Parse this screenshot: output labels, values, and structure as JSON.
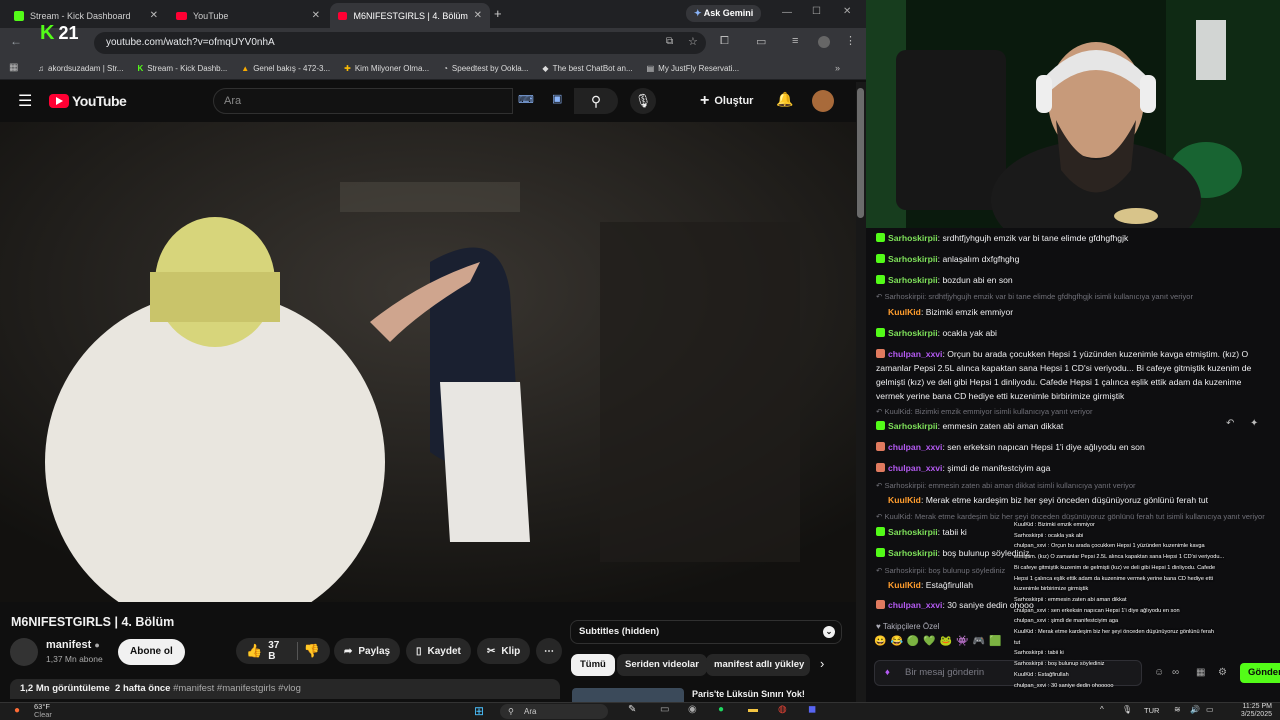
{
  "browser": {
    "tabs": [
      {
        "label": "Stream - Kick Dashboard"
      },
      {
        "label": "YouTube"
      },
      {
        "label": "M6NIFESTGIRLS | 4. Bölüm - Yo"
      }
    ],
    "ask_gemini": "Ask Gemini",
    "url": "youtube.com/watch?v=ofmqUYV0nhA",
    "bookmarks": [
      "akordsuzadam | Str...",
      "Stream - Kick Dashb...",
      "Genel bakış - 472-3...",
      "Kim Milyoner Olma...",
      "Speedtest by Ookla...",
      "The best ChatBot an...",
      "My JustFly Reservati..."
    ],
    "kick_overlay_count": "21"
  },
  "youtube": {
    "logo_text": "YouTube",
    "search_placeholder": "Ara",
    "create_label": "Oluştur",
    "video_title": "M6NIFESTGIRLS | 4. Bölüm",
    "channel_name": "manifest",
    "subscribers": "1,37 Mn abone",
    "subscribe_label": "Abone ol",
    "likes": "37 B",
    "share_label": "Paylaş",
    "save_label": "Kaydet",
    "clip_label": "Klip",
    "views": "1,2 Mn görüntüleme",
    "age": "2 hafta önce",
    "tags": "#manifest #manifestgirls #vlog",
    "subtitles": "Subtitles (hidden)",
    "chips": [
      "Tümü",
      "Seriden videolar",
      "manifest adlı yükley"
    ],
    "next_video_title": "Paris'te Lüksün Sınırı Yok!"
  },
  "chat": {
    "messages": [
      {
        "type": "msg",
        "user": "Sarhoskirpii",
        "color": "#7ee05a",
        "text": "srdhtfjyhgujh emzik var bi tane elimde gfdhgfhgjk"
      },
      {
        "type": "msg",
        "user": "Sarhoskirpii",
        "color": "#7ee05a",
        "text": "anlaşalım dxfgfhghg"
      },
      {
        "type": "msg",
        "user": "Sarhoskirpii",
        "color": "#7ee05a",
        "text": "bozdun abi en son"
      },
      {
        "type": "reply",
        "text": "Sarhoskirpii: srdhtfjyhgujh emzik var bi tane elimde gfdhgfhgjk isimli kullanıcıya yanıt veriyor"
      },
      {
        "type": "msg",
        "user": "KuulKid",
        "color": "#ff9d2e",
        "text": "Bizimki emzik emmiyor"
      },
      {
        "type": "msg",
        "user": "Sarhoskirpii",
        "color": "#7ee05a",
        "text": "ocakla yak abi"
      },
      {
        "type": "long",
        "user": "chulpan_xxvi",
        "color": "#b45af2",
        "lines": [
          "Orçun bu arada çocukken Hepsi 1 yüzünden kuzenimle kavga etmiştim. (kız) O",
          "zamanlar Pepsi 2.5L alınca kapaktan sana Hepsi 1 CD'si veriyodu... Bi cafeye gitmiştik kuzenim de",
          "gelmişti (kız) ve deli gibi Hepsi 1 dinliyodu. Cafede Hepsi 1 çalınca eşlik ettik adam da kuzenime",
          "vermek yerine bana CD hediye etti kuzenimle birbirimize girmiştik"
        ]
      },
      {
        "type": "reply",
        "text": "KuulKid: Bizimki emzik emmiyor isimli kullanıcıya yanıt veriyor"
      },
      {
        "type": "msg",
        "user": "Sarhoskirpii",
        "color": "#7ee05a",
        "text": "emmesin zaten abi aman dikkat"
      },
      {
        "type": "msg",
        "user": "chulpan_xxvi",
        "color": "#b45af2",
        "text": "sen erkeksin napıcan Hepsi 1'i diye ağlıyodu en son"
      },
      {
        "type": "msg",
        "user": "chulpan_xxvi",
        "color": "#b45af2",
        "text": "şimdi de manifestciyim aga"
      },
      {
        "type": "reply",
        "text": "Sarhoskirpii: emmesin zaten abi aman dikkat isimli kullanıcıya yanıt veriyor"
      },
      {
        "type": "msg",
        "user": "KuulKid",
        "color": "#ff9d2e",
        "text": "Merak etme kardeşim biz her şeyi önceden düşünüyoruz gönlünü ferah tut"
      },
      {
        "type": "reply",
        "text": "KuulKid: Merak etme kardeşim biz her şeyi önceden düşünüyoruz gönlünü ferah tut isimli kullanıcıya yanıt veriyor"
      },
      {
        "type": "msg",
        "user": "Sarhoskirpii",
        "color": "#7ee05a",
        "text": "tabii ki"
      },
      {
        "type": "msg",
        "user": "Sarhoskirpii",
        "color": "#7ee05a",
        "text": "boş bulunup söylediniz"
      },
      {
        "type": "reply",
        "text": "Sarhoskirpii: boş bulunup söylediniz"
      },
      {
        "type": "msg",
        "user": "KuulKid",
        "color": "#ff9d2e",
        "text": "Estağfirullah"
      },
      {
        "type": "msg",
        "user": "chulpan_xxvi",
        "color": "#b45af2",
        "text": "30 saniye dedin ohooo"
      }
    ],
    "followers_only": "Takipçilere Özel",
    "input_placeholder": "Bir mesaj gönderin",
    "send_label": "Gönder"
  },
  "overlay_chat": [
    "KuulKid : Bizimki emzik emmiyor",
    "Sarhoskirpii : ocakla yak abi",
    "chulpan_xxvi : Orçun bu arada çocukken Hepsi 1 yüzünden kuzenimle kavga",
    "etmiştim. (kız) O zamanlar Pepsi 2.5L alınca kapaktan sana Hepsi 1 CD'si veriyodu...",
    "Bi cafeye gitmiştik kuzenim de gelmişti (kız) ve deli gibi Hepsi 1 dinliyodu. Cafede",
    "Hepsi 1 çalınca eşlik ettik adam da kuzenime vermek yerine bana CD hediye etti",
    "kuzenimle birbirimize girmiştik",
    "Sarhoskirpii : emmesin zaten abi aman dikkat",
    "chulpan_xxvi : sen erkeksin napıcan Hepsi 1'i diye ağlıyodu en son",
    "chulpan_xxvi : şimdi de manifestciyim aga",
    "KuulKid : Merak etme kardeşim biz her şeyi önceden düşünüyoruz gönlünü ferah",
    "tut",
    "Sarhoskirpii : tabii ki",
    "Sarhoskirpii : boş bulunup söylediniz",
    "KuulKid : Estağfirullah",
    "chulpan_xxvi : 30 saniye dedin ohooooo"
  ],
  "taskbar": {
    "temp": "63°F",
    "weather": "Clear",
    "search": "Ara",
    "lang": "TUR",
    "time": "11:25 PM",
    "date": "3/25/2025"
  }
}
